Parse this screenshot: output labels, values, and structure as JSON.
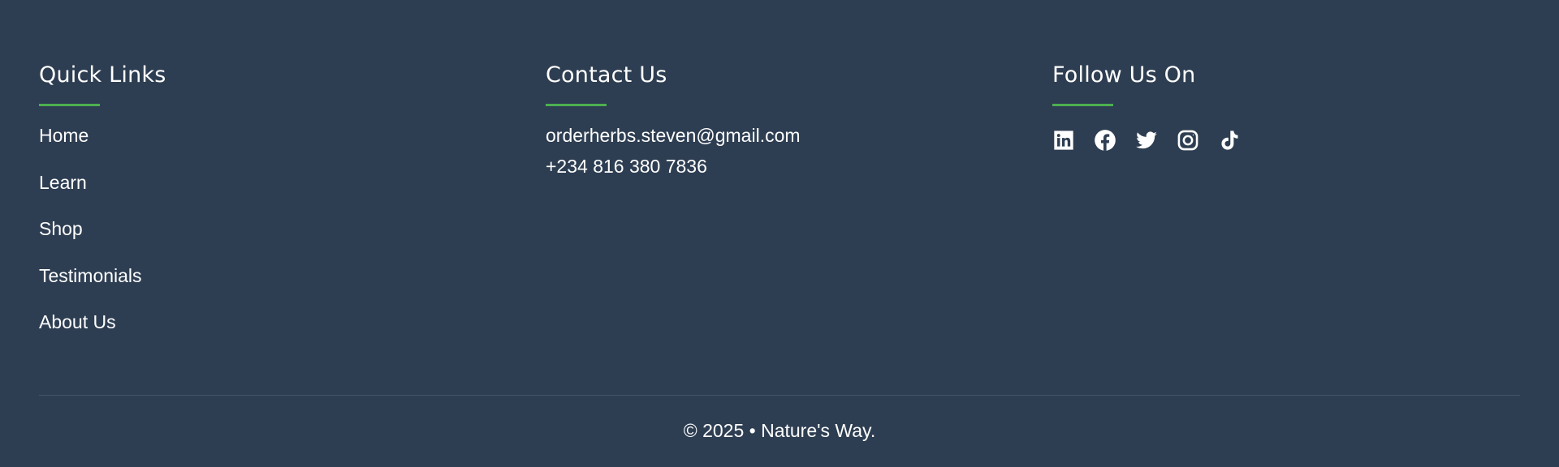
{
  "quick_links": {
    "title": "Quick Links",
    "items": [
      {
        "label": "Home"
      },
      {
        "label": "Learn"
      },
      {
        "label": "Shop"
      },
      {
        "label": "Testimonials"
      },
      {
        "label": "About Us"
      }
    ]
  },
  "contact": {
    "title": "Contact Us",
    "email": "orderherbs.steven@gmail.com",
    "phone": "+234 816 380 7836"
  },
  "follow": {
    "title": "Follow Us On",
    "icons": [
      "linkedin-icon",
      "facebook-icon",
      "twitter-icon",
      "instagram-icon",
      "tiktok-icon"
    ]
  },
  "footer_bottom": {
    "copyright": "© 2025 • Nature's Way."
  },
  "colors": {
    "background": "#2e3e52",
    "accent": "#4caf50",
    "text": "#ffffff",
    "divider": "#43546a"
  }
}
